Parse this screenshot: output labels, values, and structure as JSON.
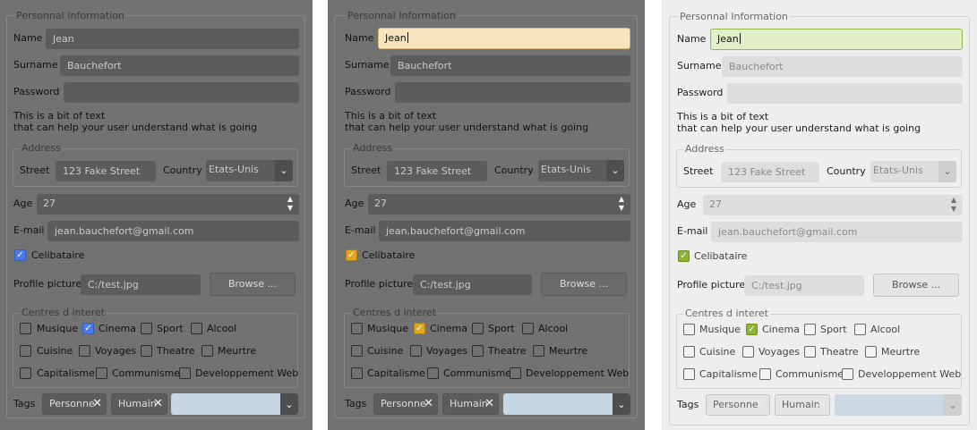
{
  "labels": {
    "personal_info": "Personnal Information",
    "name": "Name",
    "surname": "Surname",
    "password": "Password",
    "help_line1": "This is a bit of text",
    "help_line2": "that can help your user understand what is going",
    "address": "Address",
    "street": "Street",
    "country": "Country",
    "age": "Age",
    "email": "E-mail",
    "celibataire": "Celibataire",
    "profile_picture": "Profile picture",
    "browse": "Browse ...",
    "interests": "Centres d interet",
    "tags": "Tags"
  },
  "values": {
    "name": "Jean",
    "surname": "Bauchefort",
    "password": "",
    "street": "123 Fake Street",
    "country": "Etats-Unis",
    "age": "27",
    "email": "jean.bauchefort@gmail.com",
    "profile_picture": "C:/test.jpg"
  },
  "interests": [
    {
      "label": "Musique",
      "checked": false
    },
    {
      "label": "Cinema",
      "checked": true
    },
    {
      "label": "Sport",
      "checked": false
    },
    {
      "label": "Alcool",
      "checked": false
    },
    {
      "label": "Cuisine",
      "checked": false
    },
    {
      "label": "Voyages",
      "checked": false
    },
    {
      "label": "Theatre",
      "checked": false
    },
    {
      "label": "Meurtre",
      "checked": false
    },
    {
      "label": "Capitalisme",
      "checked": false
    },
    {
      "label": "Communisme",
      "checked": false
    },
    {
      "label": "Developpement Web",
      "checked": false
    }
  ],
  "celibataire_checked": true,
  "tags": [
    "Personne",
    "Humain"
  ],
  "icons": {
    "combo_arrow": "chevron-down-icon",
    "spin_arrows": "spin-up-down-icon",
    "tag_remove": "close-icon",
    "check": "checkmark-icon"
  },
  "colors": {
    "dark_background": "#727272",
    "light_background": "#eeeeee",
    "accent_blue": "#4a7be8",
    "accent_orange": "#e2a81b",
    "accent_green": "#8fb334",
    "focus_orange_field": "#f6e5be",
    "focus_green_field": "#e1f0c9",
    "tag_input": "#c7d7e6"
  }
}
